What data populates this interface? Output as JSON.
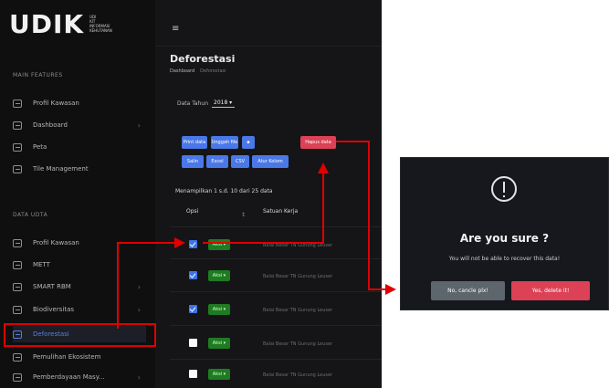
{
  "app": {
    "logo_main": "UDIK",
    "logo_sub": [
      "UDI",
      "KIT",
      "INFORMASI",
      "KEHUTANAN"
    ],
    "hamburger": "≡"
  },
  "sidebar": {
    "section_main": "MAIN FEATURES",
    "main_items": [
      {
        "label": "Profil Kawasan",
        "has_chevron": false,
        "icon": "list-icon"
      },
      {
        "label": "Dashboard",
        "has_chevron": true,
        "icon": "grid-icon"
      },
      {
        "label": "Peta",
        "has_chevron": false,
        "icon": "map-icon"
      },
      {
        "label": "Tile Management",
        "has_chevron": false,
        "icon": "window-icon"
      }
    ],
    "section_data": "DATA UDTA",
    "data_items": [
      {
        "label": "Profil Kawasan",
        "has_chevron": false,
        "icon": "list-icon"
      },
      {
        "label": "METT",
        "has_chevron": false,
        "icon": "list-icon"
      },
      {
        "label": "SMART RBM",
        "has_chevron": true,
        "icon": "list-icon"
      },
      {
        "label": "Biodiversitas",
        "has_chevron": true,
        "icon": "list-icon"
      },
      {
        "label": "Deforestasi",
        "has_chevron": false,
        "icon": "list-icon"
      },
      {
        "label": "Pemulihan Ekosistem",
        "has_chevron": false,
        "icon": "list-icon"
      },
      {
        "label": "Pemberdayaan Masy...",
        "has_chevron": true,
        "icon": "list-icon"
      }
    ]
  },
  "main": {
    "title": "Deforestasi",
    "breadcrumb": [
      "Dashboard",
      "Deforestasi"
    ],
    "filter_label": "Data Tahun",
    "filter_value": "2018 ▾",
    "buttons_row1": [
      "Print data",
      "Unggah file",
      "",
      "Hapus data"
    ],
    "buttons_row2": [
      "Salin",
      "Excel",
      "CSV",
      "Atur Kolom"
    ],
    "showing_text": "Menampilkan 1 s.d. 10 dari 25 data",
    "columns": [
      "Opsi",
      "Satuan Kerja"
    ],
    "rows": [
      {
        "checked": true,
        "status": "Aksi ▾",
        "text": "Balai Besar TN Gunung Leuser"
      },
      {
        "checked": true,
        "status": "Aksi ▾",
        "text": "Balai Besar TN Gunung Leuser"
      },
      {
        "checked": true,
        "status": "Aksi ▾",
        "text": "Balai Besar TN Gunung Leuser"
      },
      {
        "checked": false,
        "status": "Aksi ▾",
        "text": "Balai Besar TN Gunung Leuser"
      },
      {
        "checked": false,
        "status": "Aksi ▾",
        "text": "Balai Besar TN Gunung Leuser"
      }
    ]
  },
  "dialog": {
    "title": "Are you sure ?",
    "text": "You will not be able to recover this data!",
    "cancel_label": "No, cancle plx!",
    "confirm_label": "Yes, delete it!"
  },
  "colors": {
    "accent_blue": "#4a78e8",
    "danger_red": "#dc4155",
    "status_green": "#1f7b21",
    "callout_red": "#e00000"
  }
}
